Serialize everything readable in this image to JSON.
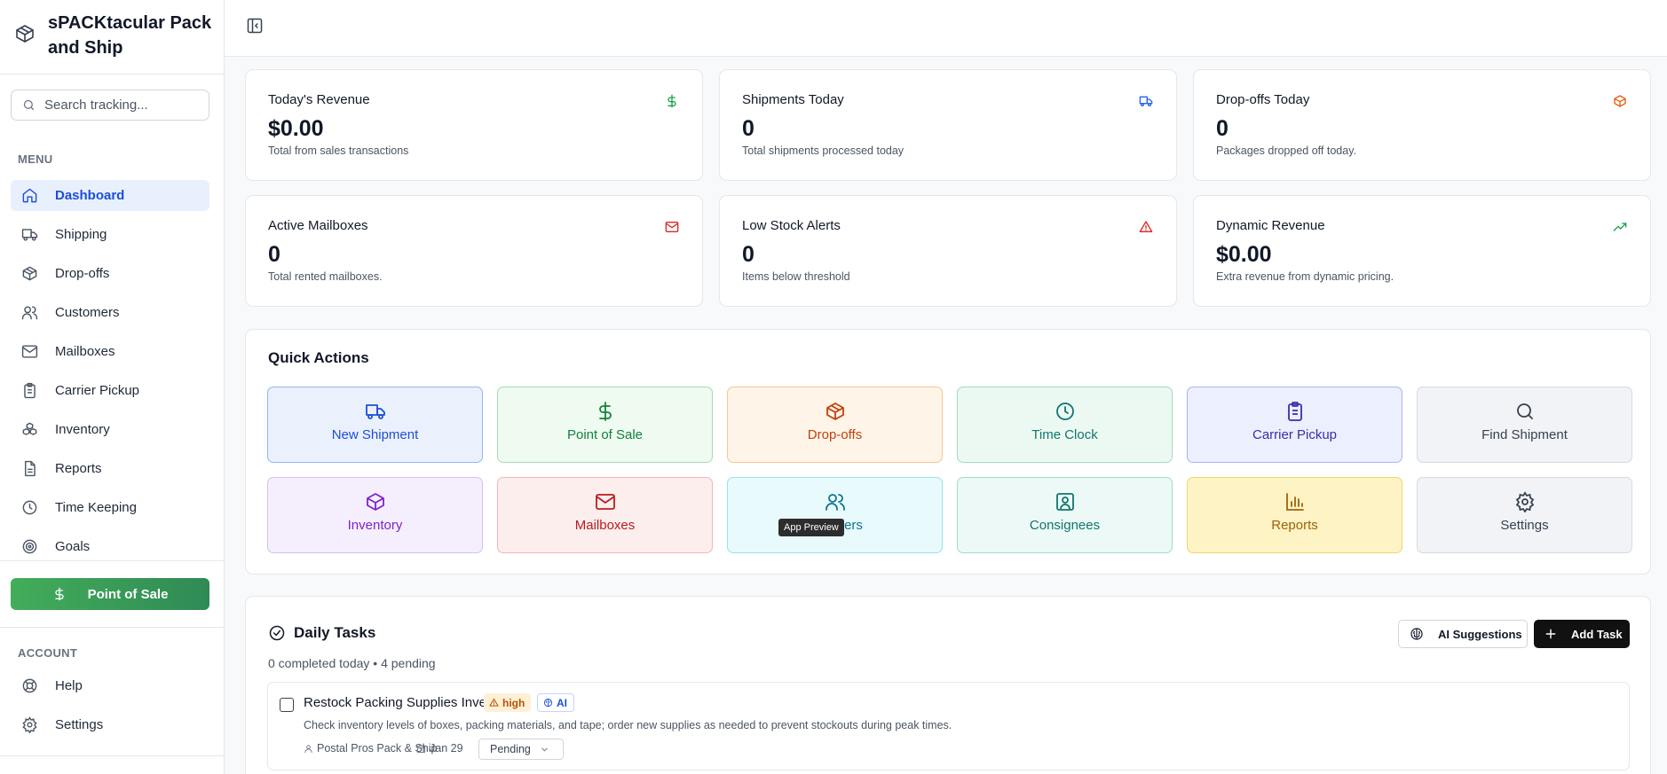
{
  "brand": {
    "title": "sPACKtacular Pack and Ship",
    "icon": "package-icon"
  },
  "search": {
    "placeholder": "Search tracking..."
  },
  "sidebar": {
    "menu_label": "MENU",
    "items": [
      {
        "label": "Dashboard",
        "icon": "home-icon",
        "active": true
      },
      {
        "label": "Shipping",
        "icon": "truck-icon"
      },
      {
        "label": "Drop-offs",
        "icon": "package-icon"
      },
      {
        "label": "Customers",
        "icon": "users-icon"
      },
      {
        "label": "Mailboxes",
        "icon": "mail-icon"
      },
      {
        "label": "Carrier Pickup",
        "icon": "clipboard-icon"
      },
      {
        "label": "Inventory",
        "icon": "boxes-icon"
      },
      {
        "label": "Reports",
        "icon": "file-text-icon"
      },
      {
        "label": "Time Keeping",
        "icon": "clock-icon"
      },
      {
        "label": "Goals",
        "icon": "target-icon"
      }
    ],
    "pos_button": "Point of Sale",
    "account_label": "ACCOUNT",
    "account_items": [
      {
        "label": "Help",
        "icon": "life-buoy-icon"
      },
      {
        "label": "Settings",
        "icon": "gear-icon"
      }
    ]
  },
  "stats": [
    {
      "label": "Today's Revenue",
      "value": "$0.00",
      "sub": "Total from sales transactions",
      "icon": "dollar-icon",
      "color": "#16a34a"
    },
    {
      "label": "Shipments Today",
      "value": "0",
      "sub": "Total shipments processed today",
      "icon": "truck-icon",
      "color": "#2563eb"
    },
    {
      "label": "Drop-offs Today",
      "value": "0",
      "sub": "Packages dropped off today.",
      "icon": "package-icon",
      "color": "#ea580c"
    },
    {
      "label": "Active Mailboxes",
      "value": "0",
      "sub": "Total rented mailboxes.",
      "icon": "mail-icon",
      "color": "#dc2626"
    },
    {
      "label": "Low Stock Alerts",
      "value": "0",
      "sub": "Items below threshold",
      "icon": "alert-triangle-icon",
      "color": "#dc2626"
    },
    {
      "label": "Dynamic Revenue",
      "value": "$0.00",
      "sub": "Extra revenue from dynamic pricing.",
      "icon": "trending-up-icon",
      "color": "#16a34a"
    }
  ],
  "quick_actions": {
    "title": "Quick Actions",
    "items": [
      {
        "label": "New Shipment",
        "icon": "truck-icon",
        "color": "#1d4ed8"
      },
      {
        "label": "Point of Sale",
        "icon": "dollar-icon",
        "color": "#15803d"
      },
      {
        "label": "Drop-offs",
        "icon": "package-icon",
        "color": "#c2410c"
      },
      {
        "label": "Time Clock",
        "icon": "clock-icon",
        "color": "#0f766e"
      },
      {
        "label": "Carrier Pickup",
        "icon": "clipboard-icon",
        "color": "#3730a3"
      },
      {
        "label": "Find Shipment",
        "icon": "search-icon",
        "color": "#374151"
      },
      {
        "label": "Inventory",
        "icon": "cube-icon",
        "color": "#7e22ce"
      },
      {
        "label": "Mailboxes",
        "icon": "mail-icon",
        "color": "#b91c1c"
      },
      {
        "label": "Customers",
        "label_visible": "ers",
        "icon": "users-icon",
        "color": "#0e7490"
      },
      {
        "label": "Consignees",
        "icon": "contact-icon",
        "color": "#0f766e"
      },
      {
        "label": "Reports",
        "icon": "bar-chart-icon",
        "color": "#a16207"
      },
      {
        "label": "Settings",
        "icon": "gear-icon",
        "color": "#374151"
      }
    ]
  },
  "tooltip": "App Preview",
  "tasks": {
    "title": "Daily Tasks",
    "subtitle": "0 completed today • 4 pending",
    "ai_button": "AI Suggestions",
    "add_button": "Add Task",
    "items": [
      {
        "name": "Restock Packing Supplies Inventory",
        "priority": "high",
        "ai_badge": "AI",
        "description": "Check inventory levels of boxes, packing materials, and tape; order new supplies as needed to prevent stockouts during peak times.",
        "assignee": "Postal Pros Pack & Ship",
        "date": "Jan 29",
        "status": "Pending"
      }
    ]
  }
}
